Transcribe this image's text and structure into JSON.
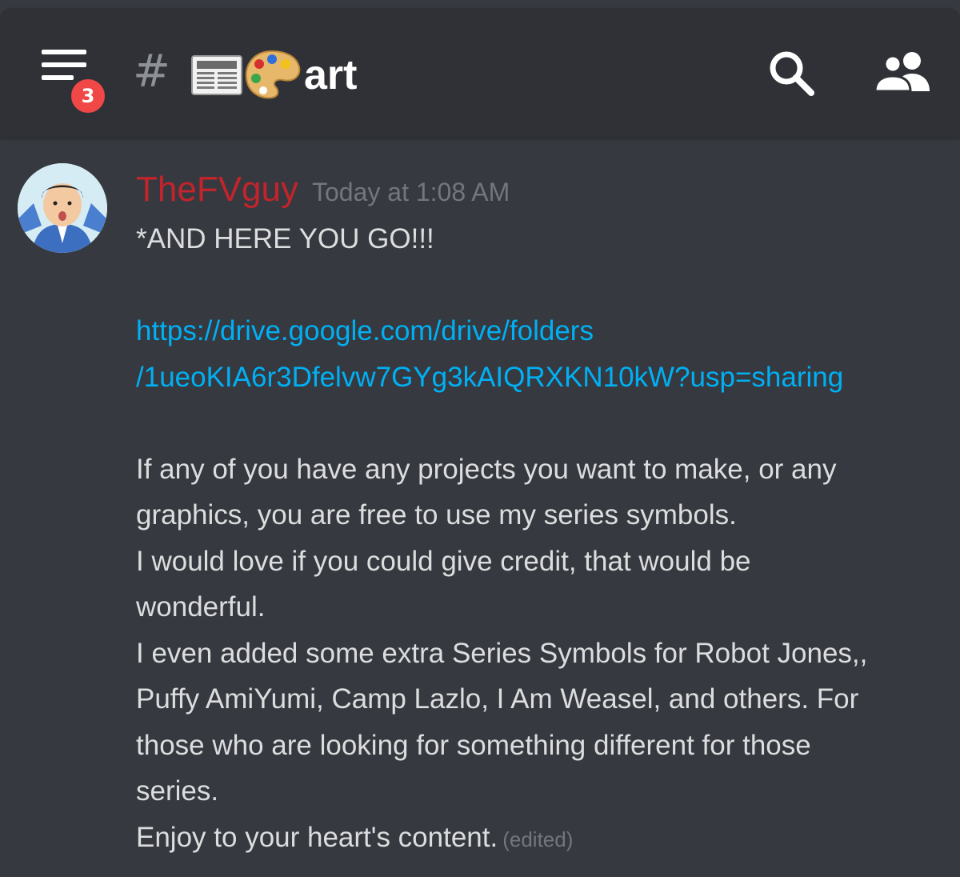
{
  "header": {
    "notification_count": "3",
    "channel_hash": "#",
    "channel_name": "art"
  },
  "message": {
    "username": "TheFVguy",
    "timestamp": "Today at 1:08 AM",
    "lines": [
      "*AND HERE YOU GO!!!",
      "",
      "https://drive.google.com/drive/folders",
      "/1ueoKIA6r3Dfelvw7GYg3kAIQRXKN10kW?usp=sharing",
      "",
      "If any of you have any projects you want to make, or any",
      "graphics, you are free to use my series symbols.",
      "I would love if you could give credit, that would be",
      "wonderful.",
      "I even added some extra Series Symbols for Robot Jones,,",
      "Puffy AmiYumi, Camp Lazlo, I Am Weasel, and others. For",
      "those who are looking for something different for those",
      "series.",
      "Enjoy to your heart's content."
    ],
    "edited_label": "(edited)"
  },
  "icons": {
    "menu": "hamburger-menu-icon",
    "channel_emoji_1": "newspaper-icon",
    "channel_emoji_2": "palette-icon",
    "search": "search-icon",
    "members": "members-icon"
  },
  "colors": {
    "background": "#36393f",
    "header": "#2f3136",
    "badge": "#f04747",
    "username": "#c2242c",
    "link": "#00b0f4",
    "text": "#dcddde",
    "muted": "#72767d"
  }
}
